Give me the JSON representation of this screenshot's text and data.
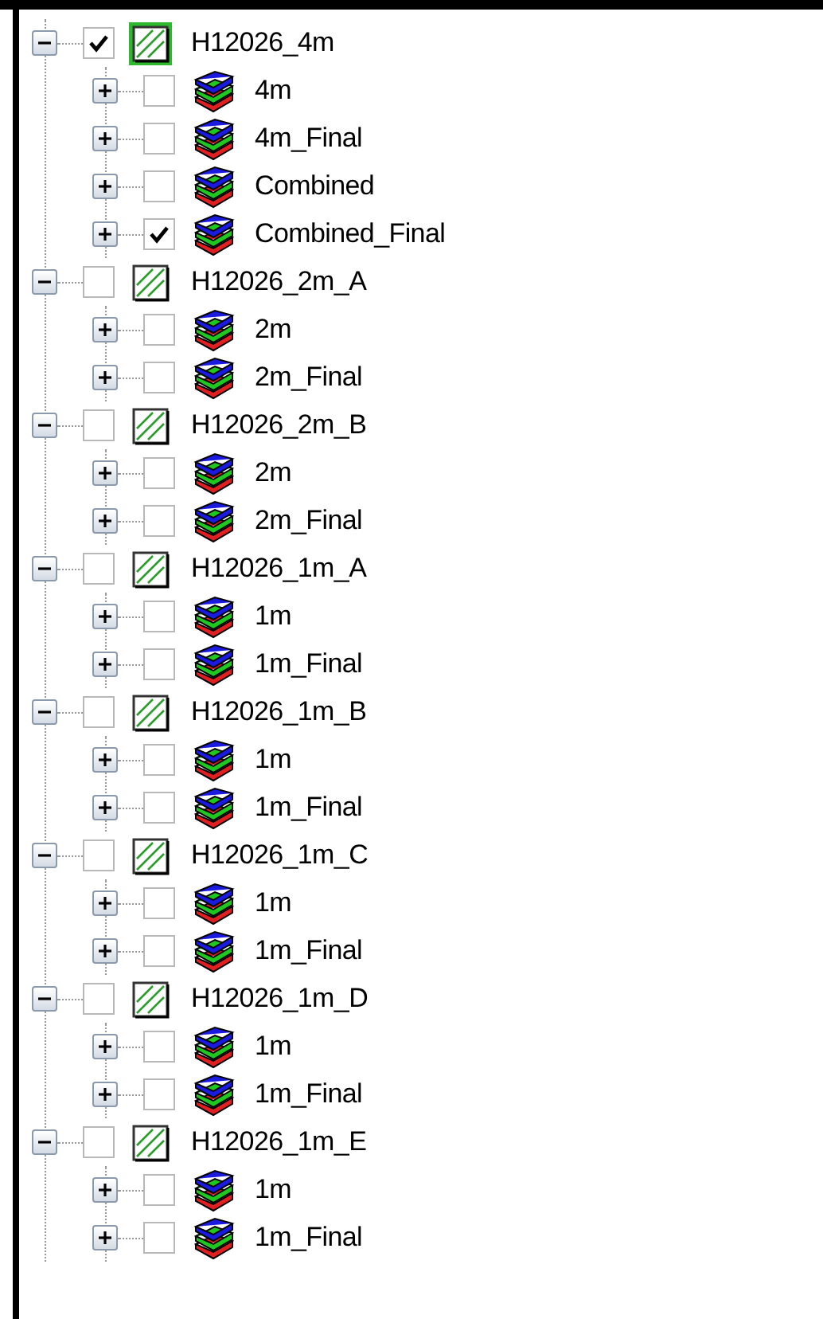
{
  "tree": {
    "items": [
      {
        "kind": "group",
        "label": "H12026_4m",
        "expanded": true,
        "checked": true,
        "selected": true,
        "children": [
          {
            "kind": "layer",
            "label": "4m",
            "expanded": false,
            "checked": false,
            "selected": false
          },
          {
            "kind": "layer",
            "label": "4m_Final",
            "expanded": false,
            "checked": false,
            "selected": false
          },
          {
            "kind": "layer",
            "label": "Combined",
            "expanded": false,
            "checked": false,
            "selected": false
          },
          {
            "kind": "layer",
            "label": "Combined_Final",
            "expanded": false,
            "checked": true,
            "selected": false
          }
        ]
      },
      {
        "kind": "group",
        "label": "H12026_2m_A",
        "expanded": true,
        "checked": false,
        "selected": false,
        "children": [
          {
            "kind": "layer",
            "label": "2m",
            "expanded": false,
            "checked": false,
            "selected": false
          },
          {
            "kind": "layer",
            "label": "2m_Final",
            "expanded": false,
            "checked": false,
            "selected": false
          }
        ]
      },
      {
        "kind": "group",
        "label": "H12026_2m_B",
        "expanded": true,
        "checked": false,
        "selected": false,
        "children": [
          {
            "kind": "layer",
            "label": "2m",
            "expanded": false,
            "checked": false,
            "selected": false
          },
          {
            "kind": "layer",
            "label": "2m_Final",
            "expanded": false,
            "checked": false,
            "selected": false
          }
        ]
      },
      {
        "kind": "group",
        "label": "H12026_1m_A",
        "expanded": true,
        "checked": false,
        "selected": false,
        "children": [
          {
            "kind": "layer",
            "label": "1m",
            "expanded": false,
            "checked": false,
            "selected": false
          },
          {
            "kind": "layer",
            "label": "1m_Final",
            "expanded": false,
            "checked": false,
            "selected": false
          }
        ]
      },
      {
        "kind": "group",
        "label": "H12026_1m_B",
        "expanded": true,
        "checked": false,
        "selected": false,
        "children": [
          {
            "kind": "layer",
            "label": "1m",
            "expanded": false,
            "checked": false,
            "selected": false
          },
          {
            "kind": "layer",
            "label": "1m_Final",
            "expanded": false,
            "checked": false,
            "selected": false
          }
        ]
      },
      {
        "kind": "group",
        "label": "H12026_1m_C",
        "expanded": true,
        "checked": false,
        "selected": false,
        "children": [
          {
            "kind": "layer",
            "label": "1m",
            "expanded": false,
            "checked": false,
            "selected": false
          },
          {
            "kind": "layer",
            "label": "1m_Final",
            "expanded": false,
            "checked": false,
            "selected": false
          }
        ]
      },
      {
        "kind": "group",
        "label": "H12026_1m_D",
        "expanded": true,
        "checked": false,
        "selected": false,
        "children": [
          {
            "kind": "layer",
            "label": "1m",
            "expanded": false,
            "checked": false,
            "selected": false
          },
          {
            "kind": "layer",
            "label": "1m_Final",
            "expanded": false,
            "checked": false,
            "selected": false
          }
        ]
      },
      {
        "kind": "group",
        "label": "H12026_1m_E",
        "expanded": true,
        "checked": false,
        "selected": false,
        "children": [
          {
            "kind": "layer",
            "label": "1m",
            "expanded": false,
            "checked": false,
            "selected": false
          },
          {
            "kind": "layer",
            "label": "1m_Final",
            "expanded": false,
            "checked": false,
            "selected": false
          }
        ]
      }
    ]
  }
}
